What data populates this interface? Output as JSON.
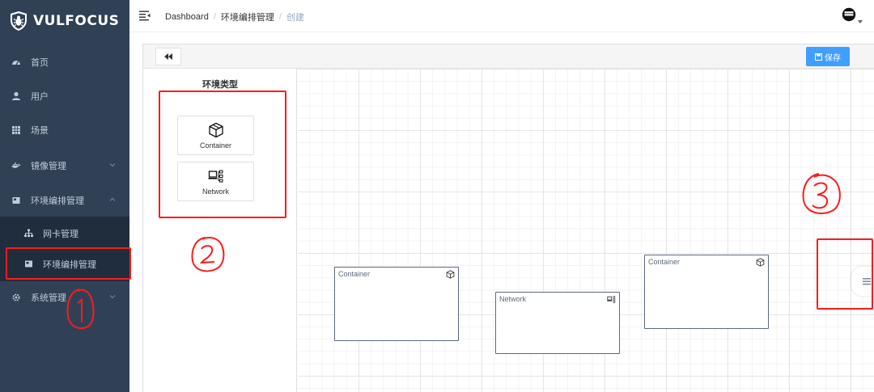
{
  "app": {
    "brand": "VULFOCUS"
  },
  "sidebar": {
    "items": [
      {
        "label": "首页",
        "icon": "dashboard-icon"
      },
      {
        "label": "用户",
        "icon": "user-icon"
      },
      {
        "label": "场景",
        "icon": "table-icon"
      },
      {
        "label": "镜像管理",
        "icon": "docker-icon",
        "expandable": true,
        "expanded": false
      },
      {
        "label": "环境编排管理",
        "icon": "layout-icon",
        "expandable": true,
        "expanded": true
      },
      {
        "label": "系统管理",
        "icon": "gear-icon",
        "expandable": true,
        "expanded": false
      }
    ],
    "subitems": [
      {
        "label": "网卡管理",
        "icon": "network-tree-icon"
      },
      {
        "label": "环境编排管理",
        "icon": "layout-icon",
        "active": true
      }
    ]
  },
  "navbar": {
    "breadcrumb": [
      "Dashboard",
      "环境编排管理",
      "创建"
    ]
  },
  "editor": {
    "save_label": "保存",
    "palette": {
      "title": "环境类型",
      "items": [
        {
          "label": "Container",
          "icon": "cube-icon"
        },
        {
          "label": "Network",
          "icon": "network-icon"
        }
      ]
    },
    "nodes": [
      {
        "title": "Container",
        "icon": "cube-icon"
      },
      {
        "title": "Network",
        "icon": "network-icon"
      },
      {
        "title": "Container",
        "icon": "cube-icon"
      }
    ]
  },
  "colors": {
    "sidebar_bg": "#304156",
    "submenu_bg": "#1f2d3d",
    "accent": "#409eff",
    "annotation": "#ff1a1a",
    "node_border": "#5b6a7d"
  }
}
